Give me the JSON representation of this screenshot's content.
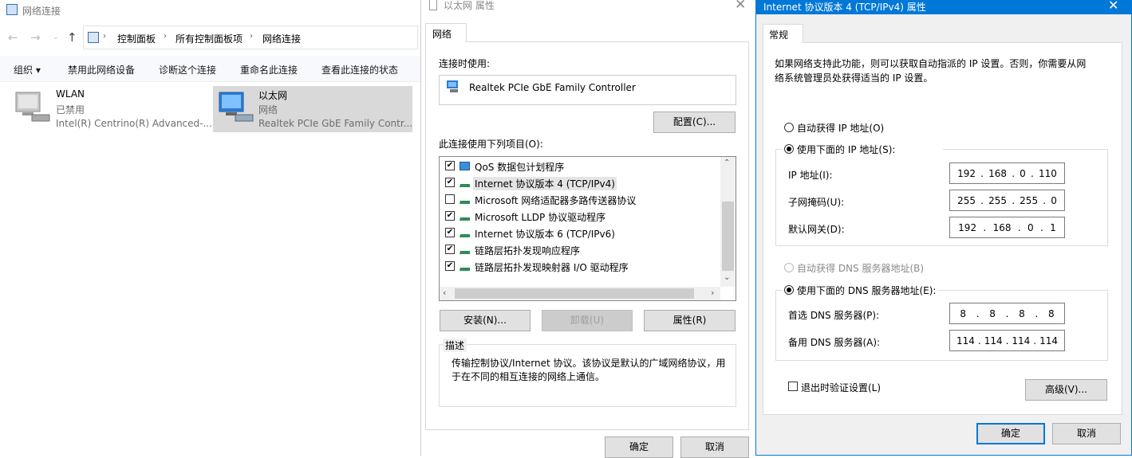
{
  "explorer": {
    "title": "网络连接",
    "breadcrumb": [
      "控制面板",
      "所有控制面板项",
      "网络连接"
    ],
    "toolbar": [
      "组织 ▾",
      "禁用此网络设备",
      "诊断这个连接",
      "重命名此连接",
      "查看此连接的状态"
    ],
    "adapters": [
      {
        "name": "WLAN",
        "status": "已禁用",
        "device": "Intel(R) Centrino(R) Advanced-..."
      },
      {
        "name": "以太网",
        "status": "网络",
        "device": "Realtek PCIe GbE Family Contr..."
      }
    ]
  },
  "props": {
    "title": "以太网 属性",
    "tab": "网络",
    "connect_using_label": "连接时使用:",
    "adapter": "Realtek PCIe GbE Family Controller",
    "configure_btn": "配置(C)...",
    "items_label": "此连接使用下列项目(O):",
    "items": [
      {
        "label": "QoS 数据包计划程序",
        "checked": true
      },
      {
        "label": "Internet 协议版本 4 (TCP/IPv4)",
        "checked": true
      },
      {
        "label": "Microsoft 网络适配器多路传送器协议",
        "checked": false
      },
      {
        "label": "Microsoft LLDP 协议驱动程序",
        "checked": true
      },
      {
        "label": "Internet 协议版本 6 (TCP/IPv6)",
        "checked": true
      },
      {
        "label": "链路层拓扑发现响应程序",
        "checked": true
      },
      {
        "label": "链路层拓扑发现映射器 I/O 驱动程序",
        "checked": true
      }
    ],
    "install_btn": "安装(N)...",
    "uninstall_btn": "卸载(U)",
    "properties_btn": "属性(R)",
    "desc_legend": "描述",
    "desc_text": "传输控制协议/Internet 协议。该协议是默认的广域网络协议，用于在不同的相互连接的网络上通信。",
    "ok_btn": "确定",
    "cancel_btn": "取消"
  },
  "ipv4": {
    "title": "Internet 协议版本 4 (TCP/IPv4) 属性",
    "tab": "常规",
    "intro": "如果网络支持此功能，则可以获取自动指派的 IP 设置。否则，你需要从网络系统管理员处获得适当的 IP 设置。",
    "auto_ip": "自动获得 IP 地址(O)",
    "use_ip": "使用下面的 IP 地址(S):",
    "ip_label": "IP 地址(I):",
    "ip": [
      "192",
      "168",
      "0",
      "110"
    ],
    "mask_label": "子网掩码(U):",
    "mask": [
      "255",
      "255",
      "255",
      "0"
    ],
    "gw_label": "默认网关(D):",
    "gw": [
      "192",
      "168",
      "0",
      "1"
    ],
    "auto_dns": "自动获得 DNS 服务器地址(B)",
    "use_dns": "使用下面的 DNS 服务器地址(E):",
    "dns1_label": "首选 DNS 服务器(P):",
    "dns1": [
      "8",
      "8",
      "8",
      "8"
    ],
    "dns2_label": "备用 DNS 服务器(A):",
    "dns2": [
      "114",
      "114",
      "114",
      "114"
    ],
    "validate": "退出时验证设置(L)",
    "advanced_btn": "高级(V)...",
    "ok_btn": "确定",
    "cancel_btn": "取消"
  },
  "colors": {
    "accent": "#0078d7",
    "selection": "#d9d9d9",
    "dialog_bg": "#f0f0f0"
  }
}
